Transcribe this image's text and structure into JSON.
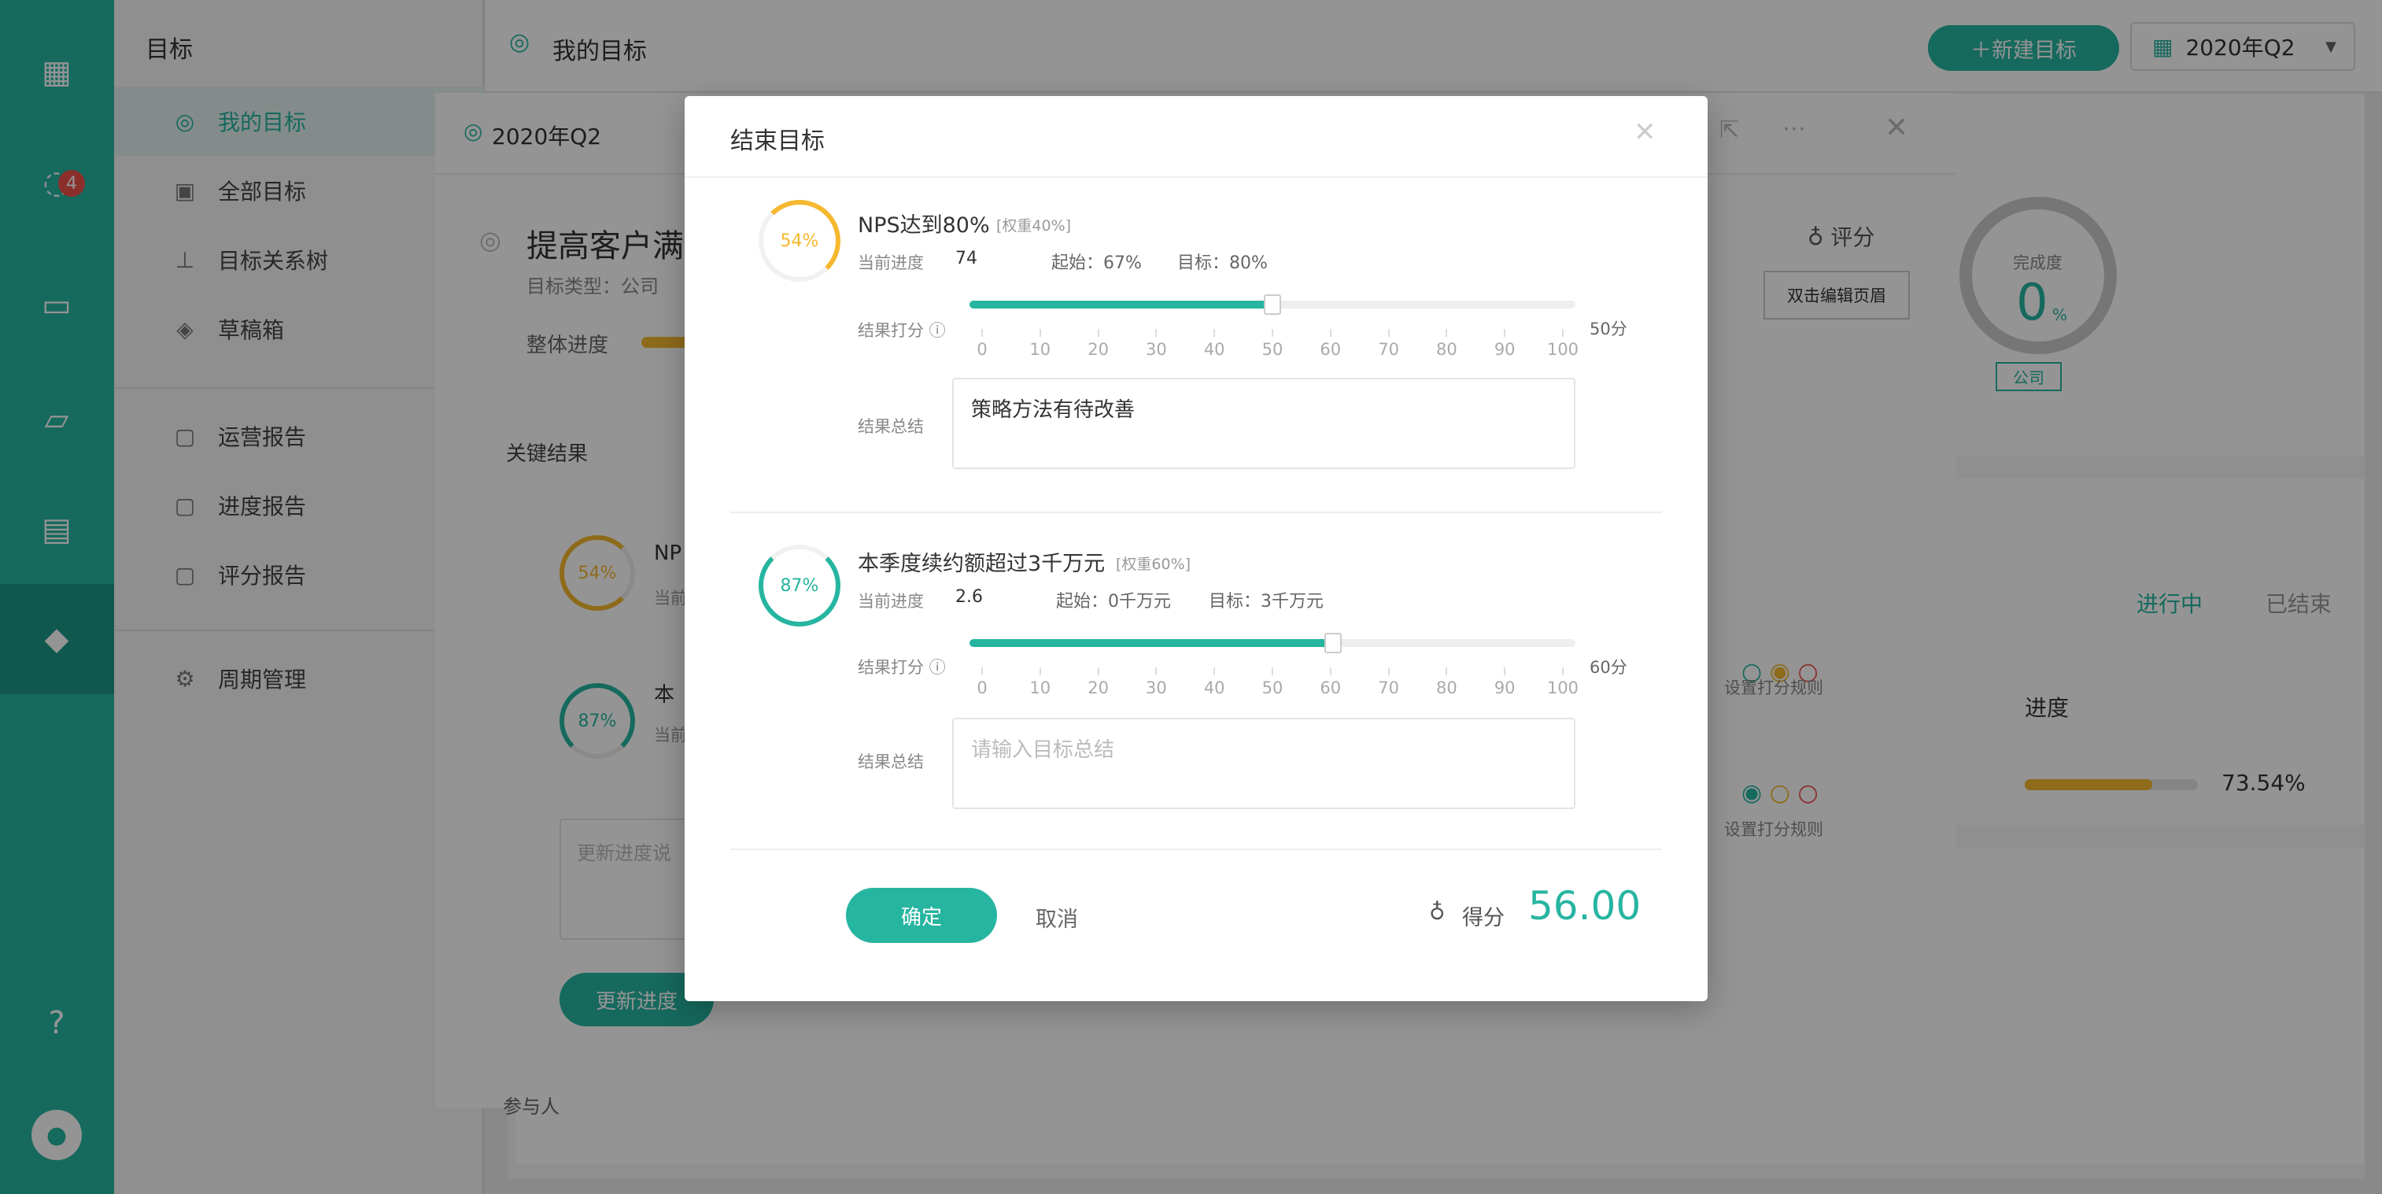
{
  "colors": {
    "accent": "#26b5a0",
    "warn": "#f5b82e",
    "danger": "#f0524a",
    "text": "#333333"
  },
  "rail": {
    "icons": [
      "grid-icon",
      "chat-icon",
      "inbox-icon",
      "folder-icon",
      "calendar-icon",
      "box-icon",
      "help-icon",
      "avatar"
    ],
    "badge": "4"
  },
  "nav": {
    "title": "目标",
    "items": [
      {
        "label": "我的目标",
        "icon": "target-icon"
      },
      {
        "label": "全部目标",
        "icon": "chart-icon"
      },
      {
        "label": "目标关系树",
        "icon": "tree-icon"
      },
      {
        "label": "草稿箱",
        "icon": "draft-icon"
      },
      {
        "label": "运营报告",
        "icon": "report-icon"
      },
      {
        "label": "进度报告",
        "icon": "progress-report-icon"
      },
      {
        "label": "评分报告",
        "icon": "score-report-icon"
      },
      {
        "label": "周期管理",
        "icon": "cycle-icon"
      }
    ]
  },
  "header": {
    "title": "我的目标",
    "new_button": "＋新建目标",
    "quarter": "2020年Q2"
  },
  "detail": {
    "quarter": "2020年Q2",
    "goal_title": "提高客户满",
    "goal_type": "目标类型：公司",
    "overall_progress": "整体进度",
    "key_results_label": "关键结果",
    "kr1_title": "NP",
    "kr1_sub": "当前",
    "kr2_title": "本",
    "kr2_sub": "当前",
    "update_placeholder": "更新进度说",
    "update_button": "更新进度",
    "participants": "参与人",
    "score_label": "评分",
    "edit_header": "双击编辑页眉",
    "completion_label": "完成度",
    "completion_value": "0",
    "completion_unit": "%",
    "company_tag": "公司",
    "tab_active": "进行中",
    "tab_done": "已结束",
    "col_progress": "进度",
    "row_progress": "73.54%",
    "rule_link1": "设置打分规则",
    "rule_link2": "设置打分规则",
    "ring1": "54%",
    "ring2": "87%"
  },
  "modal": {
    "title": "结束目标",
    "ticks": [
      "0",
      "10",
      "20",
      "30",
      "40",
      "50",
      "60",
      "70",
      "80",
      "90",
      "100"
    ],
    "kr": [
      {
        "percent": "54%",
        "progress": 0.54,
        "title": "NPS达到80%",
        "weight": "[权重40%]",
        "current_label": "当前进度",
        "current_value": "74",
        "start": "起始：67%",
        "target": "目标：80%",
        "score_label": "结果打分",
        "score_value": 50,
        "score_text": "50分",
        "summary_label": "结果总结",
        "summary_text": "策略方法有待改善",
        "summary_placeholder": ""
      },
      {
        "percent": "87%",
        "progress": 0.87,
        "title": "本季度续约额超过3千万元",
        "weight": "[权重60%]",
        "current_label": "当前进度",
        "current_value": "2.6",
        "start": "起始：0千万元",
        "target": "目标：3千万元",
        "score_label": "结果打分",
        "score_value": 60,
        "score_text": "60分",
        "summary_label": "结果总结",
        "summary_text": "",
        "summary_placeholder": "请输入目标总结"
      }
    ],
    "confirm": "确定",
    "cancel": "取消",
    "score_label": "得分",
    "score_total": "56.00"
  }
}
